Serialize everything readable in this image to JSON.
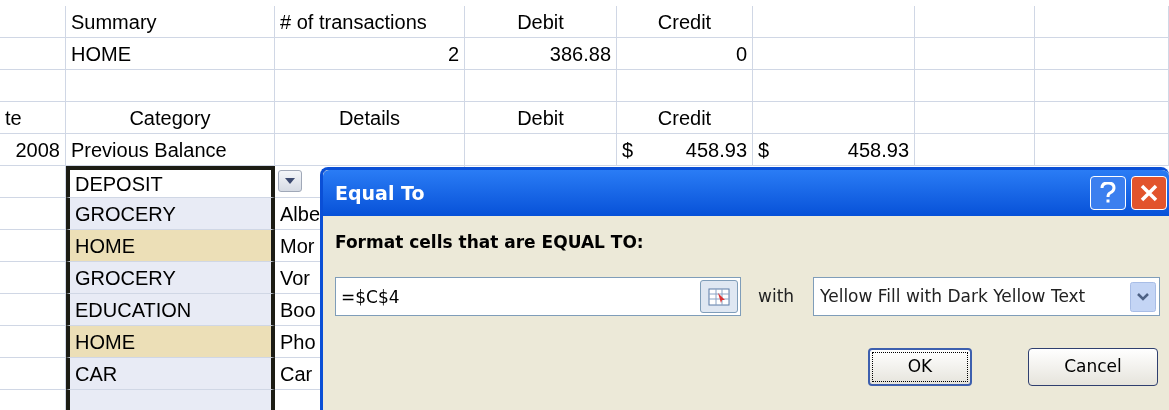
{
  "sheet": {
    "rows": [
      [
        null,
        {
          "kind": "text",
          "text": "Summary"
        },
        {
          "kind": "text",
          "text": "# of transactions"
        },
        {
          "kind": "header",
          "text": "Debit"
        },
        {
          "kind": "header",
          "text": "Credit"
        },
        null,
        null,
        null
      ],
      [
        null,
        {
          "kind": "text",
          "text": "HOME"
        },
        {
          "kind": "number",
          "text": "2"
        },
        {
          "kind": "number",
          "text": "386.88"
        },
        {
          "kind": "number",
          "text": "0"
        },
        null,
        null,
        null
      ],
      [
        null,
        null,
        null,
        null,
        null,
        null,
        null,
        null
      ],
      [
        {
          "kind": "text",
          "text": "te"
        },
        {
          "kind": "header",
          "text": "Category"
        },
        {
          "kind": "header",
          "text": "Details"
        },
        {
          "kind": "header",
          "text": "Debit"
        },
        {
          "kind": "header",
          "text": "Credit"
        },
        null,
        null,
        null
      ],
      [
        {
          "kind": "number",
          "text": "2008"
        },
        {
          "kind": "text",
          "text": "Previous Balance"
        },
        null,
        null,
        {
          "kind": "currency",
          "symbol": "$",
          "text": "458.93"
        },
        {
          "kind": "currency",
          "symbol": "$",
          "text": "458.93"
        },
        null,
        null
      ],
      [
        null,
        {
          "kind": "text",
          "text": "DEPOSIT",
          "selected": true,
          "active": true,
          "highlighted": false
        },
        null
      ],
      [
        null,
        {
          "kind": "text",
          "text": "GROCERY",
          "selected": true,
          "active": false,
          "highlighted": false
        },
        {
          "kind": "text",
          "text": "Albe"
        }
      ],
      [
        null,
        {
          "kind": "text",
          "text": "HOME",
          "selected": true,
          "active": false,
          "highlighted": true
        },
        {
          "kind": "text",
          "text": "Mor"
        }
      ],
      [
        null,
        {
          "kind": "text",
          "text": "GROCERY",
          "selected": true,
          "active": false,
          "highlighted": false
        },
        {
          "kind": "text",
          "text": "Vor"
        }
      ],
      [
        null,
        {
          "kind": "text",
          "text": "EDUCATION",
          "selected": true,
          "active": false,
          "highlighted": false
        },
        {
          "kind": "text",
          "text": "Boo"
        }
      ],
      [
        null,
        {
          "kind": "text",
          "text": "HOME",
          "selected": true,
          "active": false,
          "highlighted": true
        },
        {
          "kind": "text",
          "text": "Pho"
        }
      ],
      [
        null,
        {
          "kind": "text",
          "text": "CAR",
          "selected": true,
          "active": false,
          "highlighted": false
        },
        {
          "kind": "text",
          "text": "Car"
        }
      ],
      [
        null,
        {
          "kind": "empty",
          "selected": true,
          "active": false,
          "highlighted": false
        },
        null
      ]
    ]
  },
  "dialog": {
    "title": "Equal To",
    "prompt": "Format cells that are EQUAL TO:",
    "value": "=$C$4",
    "with_label": "with",
    "format": "Yellow Fill with Dark Yellow Text",
    "buttons": [
      {
        "label": "OK",
        "default": true
      },
      {
        "label": "Cancel",
        "default": false
      }
    ]
  }
}
